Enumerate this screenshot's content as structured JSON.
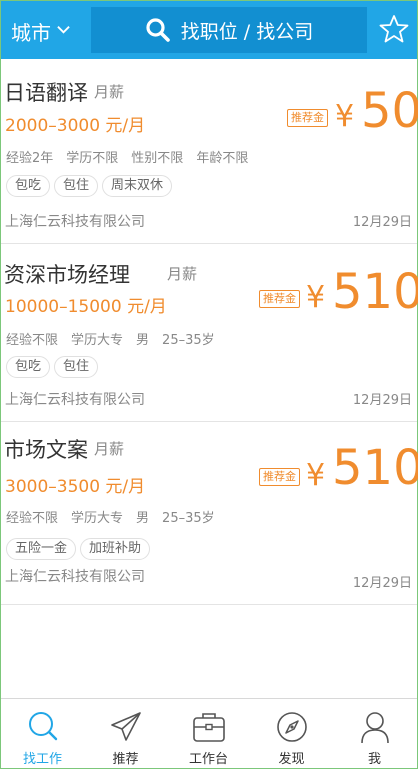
{
  "header": {
    "city_label": "城市",
    "search_placeholder": "找职位 / 找公司"
  },
  "jobs": [
    {
      "title": "日语翻译",
      "salary_unit": "月薪",
      "salary_range": "2000–3000 元/月",
      "requirements": [
        "经验2年",
        "学历不限",
        "性别不限",
        "年龄不限"
      ],
      "tags": [
        "包吃",
        "包住",
        "周末双休"
      ],
      "company": "上海仁云科技有限公司",
      "date": "12月29日",
      "badge": "推荐金",
      "currency": "¥",
      "reward": "50"
    },
    {
      "title": "资深市场经理",
      "salary_unit": "月薪",
      "salary_range": "10000–15000 元/月",
      "requirements": [
        "经验不限",
        "学历大专",
        "男",
        "25–35岁"
      ],
      "tags": [
        "包吃",
        "包住"
      ],
      "company": "上海仁云科技有限公司",
      "date": "12月29日",
      "badge": "推荐金",
      "currency": "¥",
      "reward": "510"
    },
    {
      "title": "市场文案",
      "salary_unit": "月薪",
      "salary_range": "3000–3500 元/月",
      "requirements": [
        "经验不限",
        "学历大专",
        "男",
        "25–35岁"
      ],
      "tags": [
        "五险一金",
        "加班补助"
      ],
      "company": "上海仁云科技有限公司",
      "date": "12月29日",
      "badge": "推荐金",
      "currency": "¥",
      "reward": "510"
    }
  ],
  "nav": [
    {
      "label": "找工作",
      "icon": "search-icon",
      "active": true
    },
    {
      "label": "推荐",
      "icon": "paper-plane-icon",
      "active": false
    },
    {
      "label": "工作台",
      "icon": "briefcase-icon",
      "active": false
    },
    {
      "label": "发现",
      "icon": "compass-icon",
      "active": false
    },
    {
      "label": "我",
      "icon": "user-icon",
      "active": false
    }
  ],
  "colors": {
    "header": "#21a6e6",
    "search_box": "#128fd1",
    "accent_orange": "#f08c2e",
    "nav_active": "#21a6e6"
  }
}
